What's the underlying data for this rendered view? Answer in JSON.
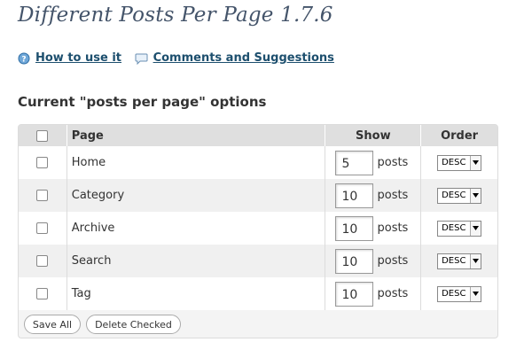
{
  "title": "Different Posts Per Page 1.7.6",
  "links": [
    {
      "label": "How to use it",
      "icon": "help-icon"
    },
    {
      "label": "Comments and Suggestions",
      "icon": "speech-bubble-icon"
    }
  ],
  "section_title": "Current \"posts per page\" options",
  "table": {
    "columns": [
      "Page",
      "Show",
      "Order"
    ],
    "rows": [
      {
        "page": "Home",
        "count": "5",
        "unit": "posts",
        "order": "DESC"
      },
      {
        "page": "Category",
        "count": "10",
        "unit": "posts",
        "order": "DESC"
      },
      {
        "page": "Archive",
        "count": "10",
        "unit": "posts",
        "order": "DESC"
      },
      {
        "page": "Search",
        "count": "10",
        "unit": "posts",
        "order": "DESC"
      },
      {
        "page": "Tag",
        "count": "10",
        "unit": "posts",
        "order": "DESC"
      }
    ]
  },
  "buttons": {
    "save_all": "Save All",
    "delete_checked": "Delete Checked"
  },
  "colors": {
    "title": "#44546a",
    "link": "#1d4f6e",
    "header_bg": "#dfdfdf",
    "alt_row": "#f0f0f0"
  }
}
